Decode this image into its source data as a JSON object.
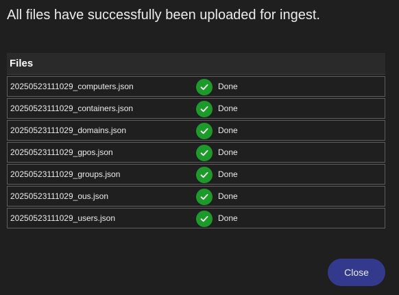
{
  "dialog": {
    "message": "All files have successfully been uploaded for ingest.",
    "table_header": "Files",
    "files": [
      {
        "name": "20250523111029_computers.json",
        "status": "Done"
      },
      {
        "name": "20250523111029_containers.json",
        "status": "Done"
      },
      {
        "name": "20250523111029_domains.json",
        "status": "Done"
      },
      {
        "name": "20250523111029_gpos.json",
        "status": "Done"
      },
      {
        "name": "20250523111029_groups.json",
        "status": "Done"
      },
      {
        "name": "20250523111029_ous.json",
        "status": "Done"
      },
      {
        "name": "20250523111029_users.json",
        "status": "Done"
      }
    ],
    "status_icon": "check-circle-icon",
    "close_label": "Close"
  },
  "colors": {
    "background": "#1f1f1f",
    "header_background": "#2a2a2a",
    "row_border": "#5e5e5e",
    "success": "#1e9a2a",
    "button": "#333a8e",
    "text": "#ececec"
  }
}
